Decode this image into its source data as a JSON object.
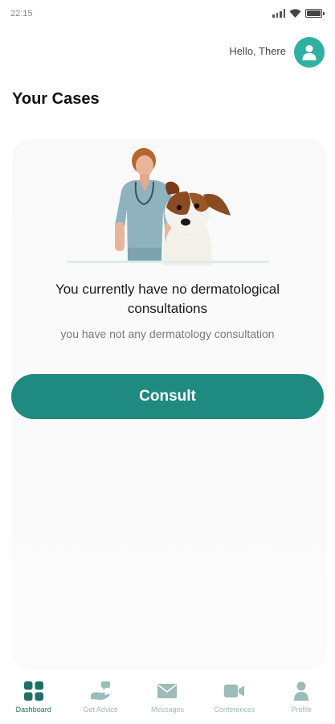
{
  "status_bar": {
    "time": "22:15"
  },
  "header": {
    "greeting": "Hello, There"
  },
  "page": {
    "title": "Your Cases"
  },
  "empty_state": {
    "title": "You currently have no dermatological consultations",
    "subtitle": "you have not any dermatology consultation"
  },
  "actions": {
    "consult_label": "Consult"
  },
  "colors": {
    "accent": "#1f8a80",
    "avatar": "#2fb0a2",
    "nav_inactive": "#9bbcb9",
    "nav_active": "#1f6f67"
  },
  "nav": {
    "items": [
      {
        "label": "Dashboard",
        "icon": "dashboard-grid-icon",
        "active": true
      },
      {
        "label": "Get Advice",
        "icon": "advice-hand-icon",
        "active": false
      },
      {
        "label": "Messages",
        "icon": "envelope-icon",
        "active": false
      },
      {
        "label": "Conferences",
        "icon": "video-camera-icon",
        "active": false
      },
      {
        "label": "Profile",
        "icon": "profile-icon",
        "active": false
      }
    ]
  }
}
